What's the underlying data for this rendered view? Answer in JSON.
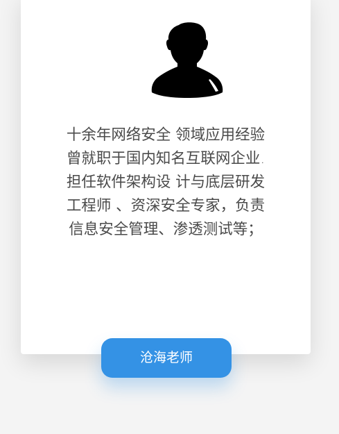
{
  "profile": {
    "avatar_icon": "person-silhouette-icon",
    "bio_lines": [
      "十余年网络安全 领域应用经验",
      "曾就职于国内知名互联网企业.",
      "担任软件架构设 计与底层研发",
      "工程师 、资深安全专家，负责",
      "信息安全管理、渗透测试等；"
    ],
    "name_button_label": "沧海老师",
    "accent_color": "#3492e5"
  }
}
